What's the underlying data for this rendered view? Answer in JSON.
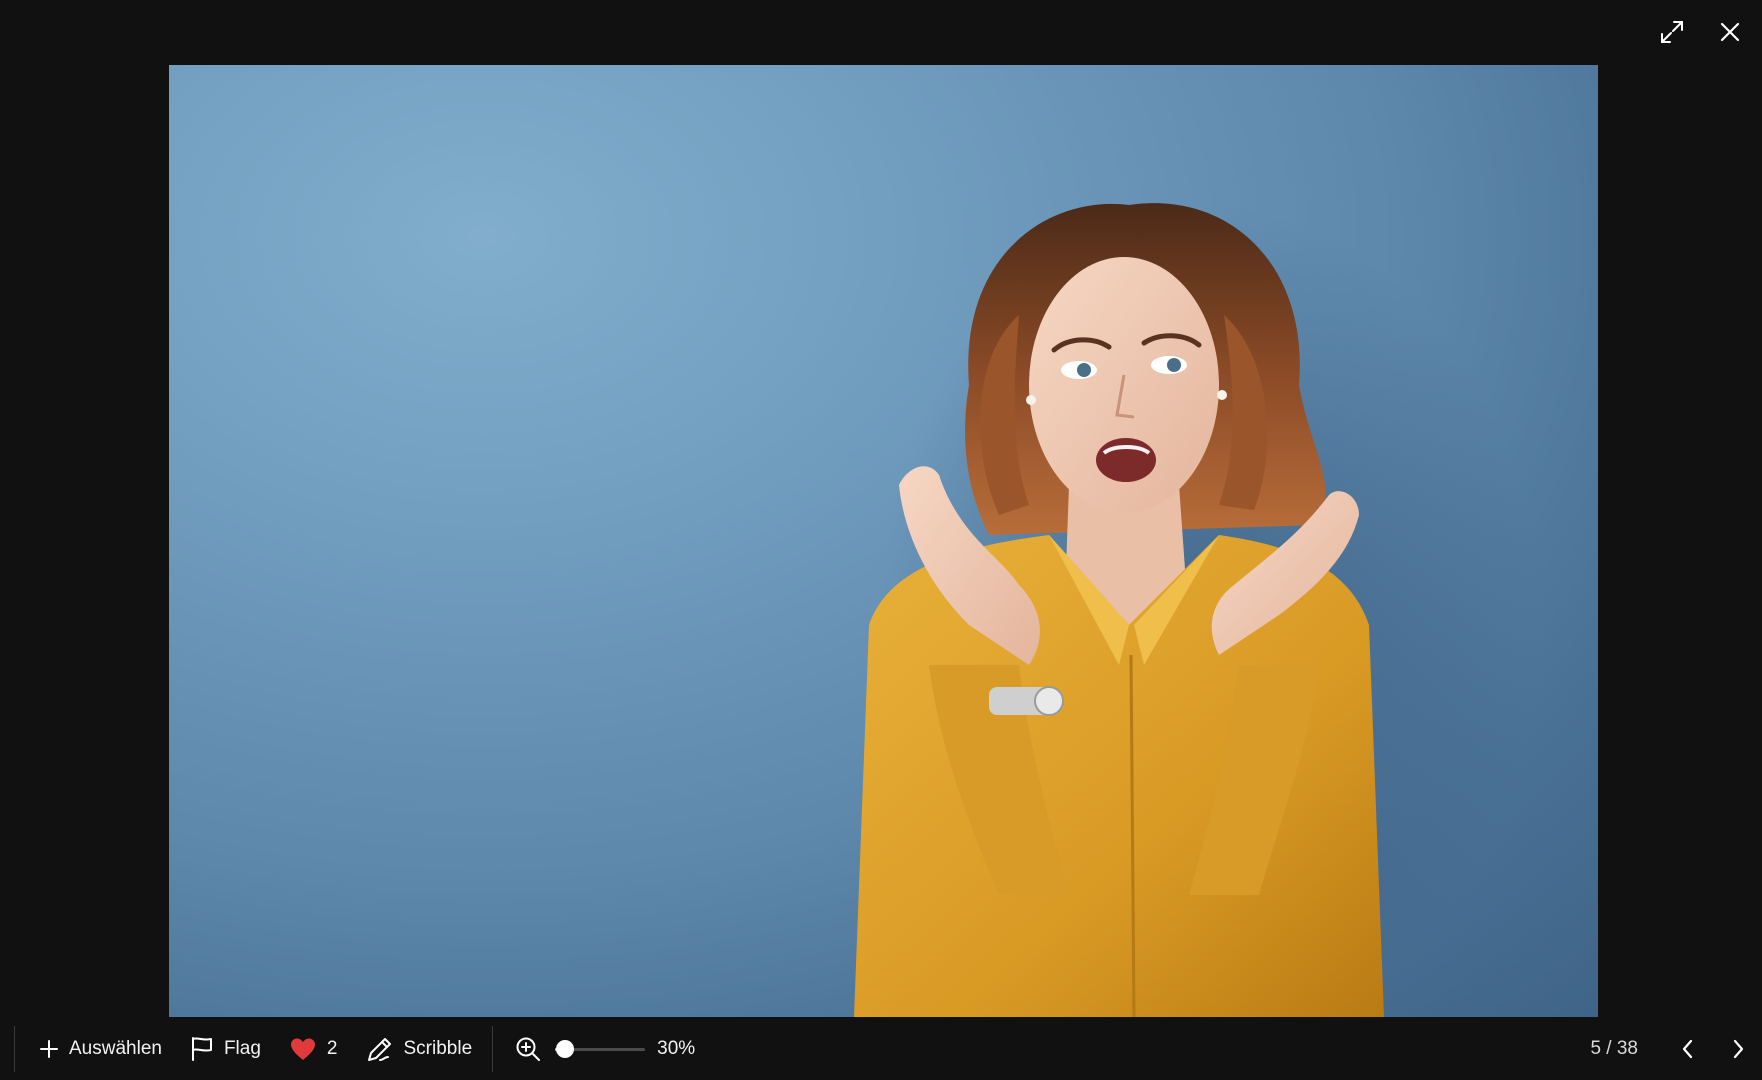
{
  "toolbar": {
    "select_label": "Auswählen",
    "flag_label": "Flag",
    "likes_count": "2",
    "scribble_label": "Scribble",
    "zoom_percent": 30,
    "zoom_label": "30%",
    "page_counter": "5 / 38"
  },
  "icons": {
    "expand": "expand-icon",
    "close": "close-icon",
    "plus": "plus-icon",
    "flag": "flag-icon",
    "heart": "heart-icon",
    "scribble": "pen-icon",
    "zoom_in": "zoom-in-icon",
    "prev": "chevron-left-icon",
    "next": "chevron-right-icon"
  },
  "colors": {
    "background": "#111112",
    "heart": "#e23a3a",
    "text": "#f2f2f2"
  }
}
